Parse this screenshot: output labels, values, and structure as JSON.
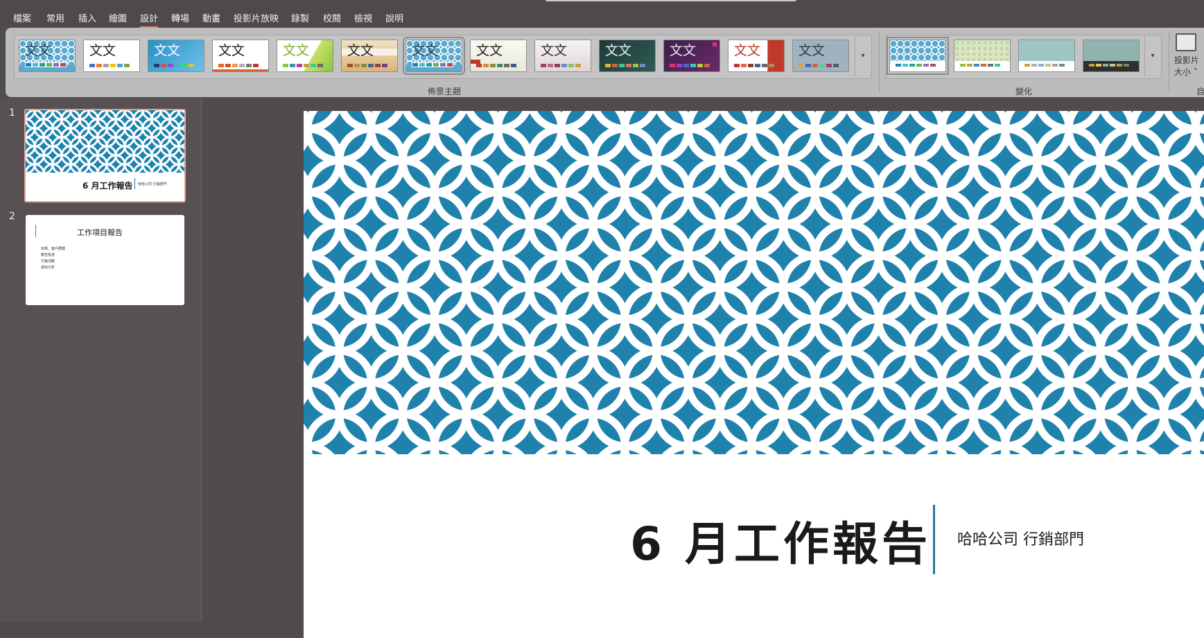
{
  "menu": {
    "items": [
      "檔案",
      "常用",
      "插入",
      "繪圖",
      "設計",
      "轉場",
      "動畫",
      "投影片放映",
      "錄製",
      "校閱",
      "檢視",
      "說明"
    ],
    "active": "設計"
  },
  "ribbon": {
    "themes_group_label": "佈景主題",
    "variants_group_label": "變化",
    "theme_sample_text": "文文",
    "slide_size_label": "投影片\n大小",
    "slide_size_line1": "投影片",
    "slide_size_line2": "大小 ˅",
    "more_glyph": "⩡",
    "cut_label": "自"
  },
  "slides": [
    {
      "number": "1",
      "title": "6 月工作報告",
      "subtitle": "哈哈公司 行銷部門",
      "subtitle_small": "哈哈公司 行銷部門"
    },
    {
      "number": "2",
      "title": "工作項目報告",
      "bullets": [
        "目標、客戶群體",
        "廣告投放",
        "行銷活動",
        "成效分析"
      ]
    }
  ],
  "colors": {
    "accent": "#1e82ad",
    "selection": "#e8a08f",
    "ribbon": "#bcbcbc",
    "background": "#514b4d"
  }
}
